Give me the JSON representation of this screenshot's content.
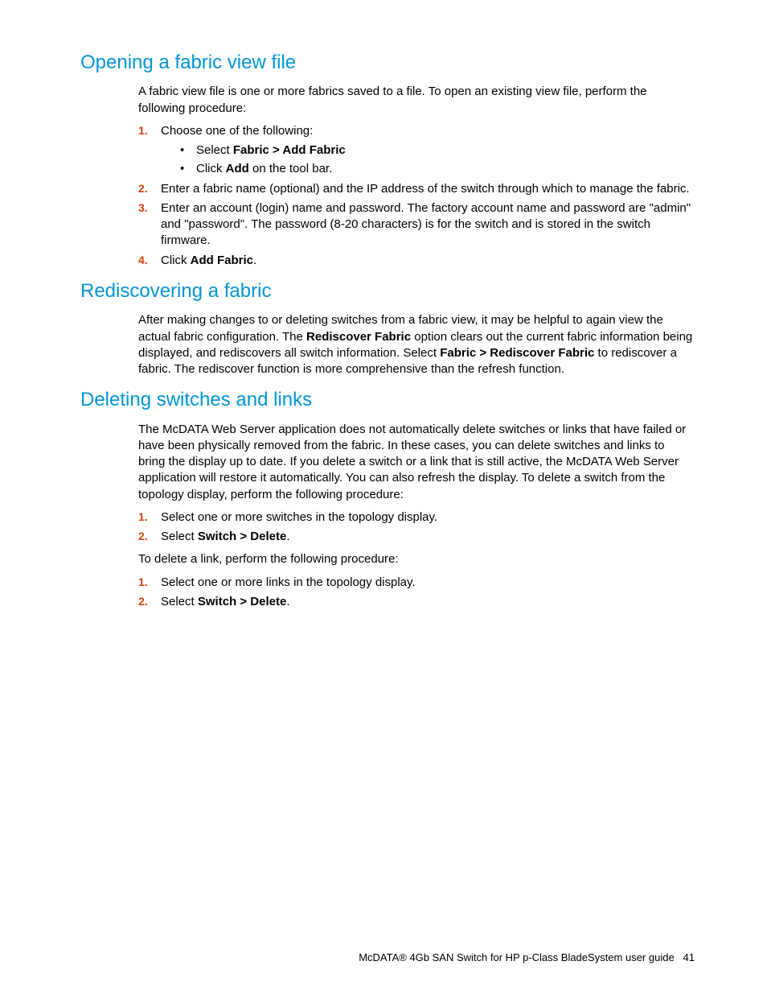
{
  "sections": {
    "s1": {
      "title": "Opening a fabric view file",
      "intro": "A fabric view file is one or more fabrics saved to a file. To open an existing view file, perform the following procedure:",
      "step1": "Choose one of the following:",
      "bullet1_pre": "Select ",
      "bullet1_bold": "Fabric > Add Fabric",
      "bullet2_pre": "Click ",
      "bullet2_bold": "Add",
      "bullet2_post": " on the tool bar.",
      "step2": "Enter a fabric name (optional) and the IP address of the switch through which to manage the fabric.",
      "step3": "Enter an account (login) name and password. The factory account name and password are \"admin\" and \"password\". The password (8-20 characters) is for the switch and is stored in the switch firmware.",
      "step4_pre": "Click ",
      "step4_bold": "Add Fabric",
      "step4_post": "."
    },
    "s2": {
      "title": "Rediscovering a fabric",
      "para_a": "After making changes to or deleting switches from a fabric view, it may be helpful to again view the actual fabric configuration. The ",
      "bold1": "Rediscover Fabric",
      "para_b": " option clears out the current fabric information being displayed, and rediscovers all switch information. Select ",
      "bold2": "Fabric > Rediscover Fabric",
      "para_c": " to rediscover a fabric. The rediscover function is more comprehensive than the refresh function."
    },
    "s3": {
      "title": "Deleting switches and links",
      "intro": "The McDATA Web Server application does not automatically delete switches or links that have failed or have been physically removed from the fabric. In these cases, you can delete switches and links to bring the display up to date. If you delete a switch or a link that is still active, the McDATA Web Server application will restore it automatically. You can also refresh the display. To delete a switch from the topology display, perform the following procedure:",
      "stepA1": "Select one or more switches in the topology display.",
      "stepA2_pre": "Select ",
      "stepA2_bold": "Switch > Delete",
      "stepA2_post": ".",
      "mid": "To delete a link, perform the following procedure:",
      "stepB1": "Select one or more links in the topology display.",
      "stepB2_pre": "Select ",
      "stepB2_bold": "Switch > Delete",
      "stepB2_post": "."
    }
  },
  "nums": {
    "n1": "1.",
    "n2": "2.",
    "n3": "3.",
    "n4": "4."
  },
  "footer": {
    "text": "McDATA® 4Gb SAN Switch for HP p-Class BladeSystem user guide",
    "page": "41"
  }
}
